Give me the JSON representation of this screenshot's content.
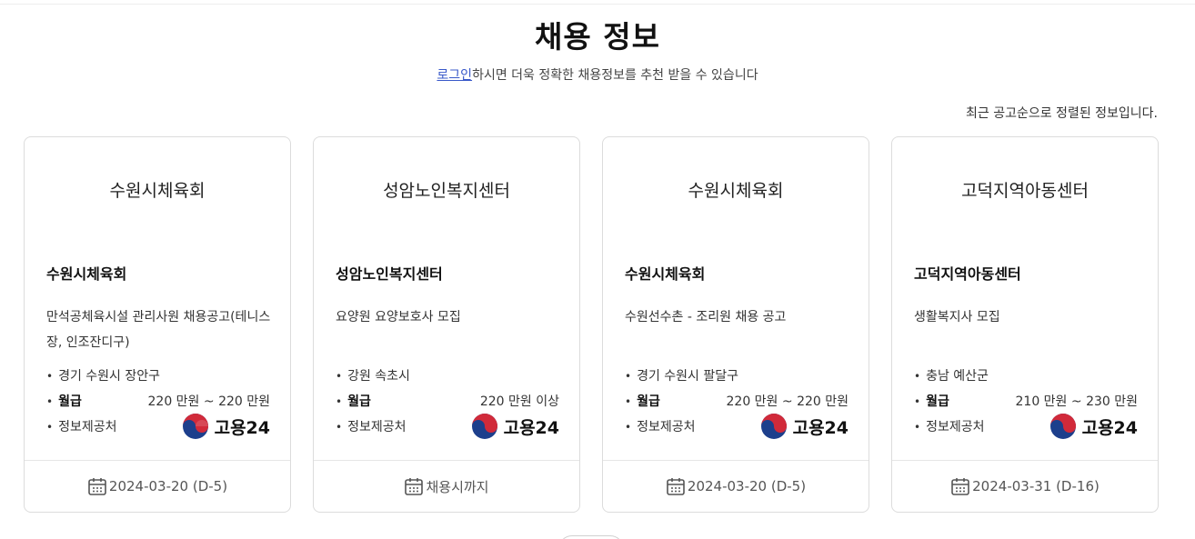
{
  "header": {
    "title": "채용 정보",
    "login_link": "로그인",
    "subtitle_rest": "하시면 더욱 정확한 채용정보를 추천 받을 수 있습니다",
    "sort_note": "최근 공고순으로 정렬된 정보입니다."
  },
  "cards": [
    {
      "org_title": "수원시체육회",
      "org_name": "수원시체육회",
      "job_title": "만석공체육시설 관리사원 채용공고(테니스장, 인조잔디구)",
      "location": "경기 수원시 장안구",
      "pay_label": "월급",
      "pay": "220 만원 ~ 220 만원",
      "source_label": "정보제공처",
      "source_logo": "고용24",
      "deadline": "2024-03-20 (D-5)"
    },
    {
      "org_title": "성암노인복지센터",
      "org_name": "성암노인복지센터",
      "job_title": "요양원 요양보호사 모집",
      "location": "강원 속초시",
      "pay_label": "월급",
      "pay": "220 만원 이상",
      "source_label": "정보제공처",
      "source_logo": "고용24",
      "deadline": "채용시까지"
    },
    {
      "org_title": "수원시체육회",
      "org_name": "수원시체육회",
      "job_title": "수원선수촌 - 조리원 채용 공고",
      "location": "경기 수원시 팔달구",
      "pay_label": "월급",
      "pay": "220 만원 ~ 220 만원",
      "source_label": "정보제공처",
      "source_logo": "고용24",
      "deadline": "2024-03-20 (D-5)"
    },
    {
      "org_title": "고덕지역아동센터",
      "org_name": "고덕지역아동센터",
      "job_title": "생활복지사 모집",
      "location": "충남 예산군",
      "pay_label": "월급",
      "pay": "210 만원 ~ 230 만원",
      "source_label": "정보제공처",
      "source_logo": "고용24",
      "deadline": "2024-03-31 (D-16)"
    }
  ],
  "icons": {
    "calendar": "calendar-icon",
    "logo": "government-emblem-icon"
  },
  "colors": {
    "link": "#3858c9",
    "emblem_red": "#d12a3a",
    "emblem_blue": "#1d3f8c"
  }
}
